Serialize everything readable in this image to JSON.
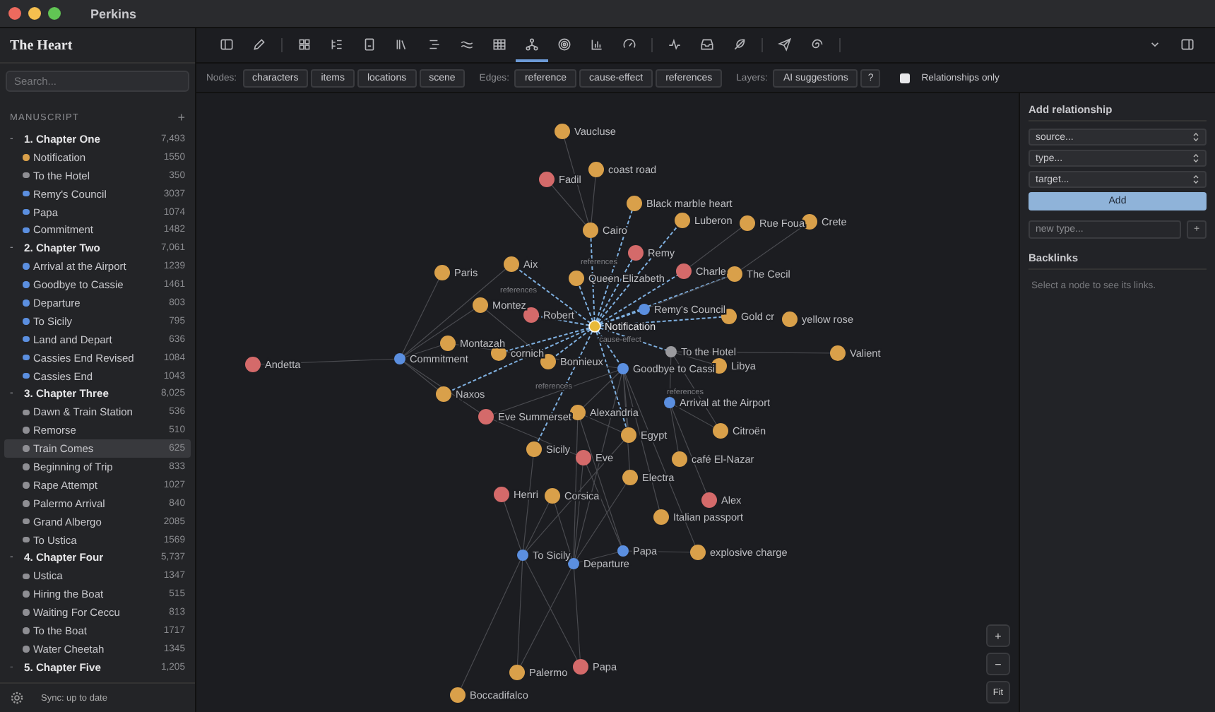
{
  "window": {
    "title": "Perkins"
  },
  "sidebar": {
    "project_title": "The Heart",
    "search": {
      "placeholder": "Search..."
    },
    "section_label": "MANUSCRIPT",
    "add_button": "+",
    "chapters": [
      {
        "toggle": "-",
        "title": "1. Chapter One",
        "count": "7,493",
        "expanded": true,
        "children": [
          {
            "title": "Notification",
            "count": "1550",
            "color": "#d9a04a",
            "selected": false
          },
          {
            "title": "To the Hotel",
            "count": "350",
            "color": "#8e8e93",
            "selected": false
          },
          {
            "title": "Remy's Council",
            "count": "3037",
            "color": "#5b8fe0",
            "selected": false
          },
          {
            "title": "Papa",
            "count": "1074",
            "color": "#5b8fe0",
            "selected": false
          },
          {
            "title": "Commitment",
            "count": "1482",
            "color": "#5b8fe0",
            "selected": false
          }
        ]
      },
      {
        "toggle": "-",
        "title": "2. Chapter Two",
        "count": "7,061",
        "expanded": true,
        "children": [
          {
            "title": "Arrival at the Airport",
            "count": "1239",
            "color": "#5b8fe0",
            "selected": false
          },
          {
            "title": "Goodbye to Cassie",
            "count": "1461",
            "color": "#5b8fe0",
            "selected": false
          },
          {
            "title": "Departure",
            "count": "803",
            "color": "#5b8fe0",
            "selected": false
          },
          {
            "title": "To Sicily",
            "count": "795",
            "color": "#5b8fe0",
            "selected": false
          },
          {
            "title": "Land and Depart",
            "count": "636",
            "color": "#5b8fe0",
            "selected": false
          },
          {
            "title": "Cassies End Revised",
            "count": "1084",
            "color": "#5b8fe0",
            "selected": false
          },
          {
            "title": "Cassies End",
            "count": "1043",
            "color": "#5b8fe0",
            "selected": false
          }
        ]
      },
      {
        "toggle": "-",
        "title": "3. Chapter Three",
        "count": "8,025",
        "expanded": true,
        "children": [
          {
            "title": "Dawn & Train Station",
            "count": "536",
            "color": "#8e8e93",
            "selected": false
          },
          {
            "title": "Remorse",
            "count": "510",
            "color": "#8e8e93",
            "selected": false
          },
          {
            "title": "Train Comes",
            "count": "625",
            "color": "#8e8e93",
            "selected": true
          },
          {
            "title": "Beginning of Trip",
            "count": "833",
            "color": "#8e8e93",
            "selected": false
          },
          {
            "title": "Rape Attempt",
            "count": "1027",
            "color": "#8e8e93",
            "selected": false
          },
          {
            "title": "Palermo Arrival",
            "count": "840",
            "color": "#8e8e93",
            "selected": false
          },
          {
            "title": "Grand Albergo",
            "count": "2085",
            "color": "#8e8e93",
            "selected": false
          },
          {
            "title": "To Ustica",
            "count": "1569",
            "color": "#8e8e93",
            "selected": false
          }
        ]
      },
      {
        "toggle": "-",
        "title": "4. Chapter Four",
        "count": "5,737",
        "expanded": true,
        "children": [
          {
            "title": "Ustica",
            "count": "1347",
            "color": "#8e8e93",
            "selected": false
          },
          {
            "title": "Hiring the Boat",
            "count": "515",
            "color": "#8e8e93",
            "selected": false
          },
          {
            "title": "Waiting For Ceccu",
            "count": "813",
            "color": "#8e8e93",
            "selected": false
          },
          {
            "title": "To the Boat",
            "count": "1717",
            "color": "#8e8e93",
            "selected": false
          },
          {
            "title": "Water Cheetah",
            "count": "1345",
            "color": "#8e8e93",
            "selected": false
          }
        ]
      },
      {
        "toggle": "-",
        "title": "5. Chapter Five",
        "count": "1,205",
        "expanded": false
      }
    ],
    "status": "Sync: up to date"
  },
  "toolbar": [
    {
      "selected": false
    },
    {
      "selected": false
    },
    {
      "selected": false
    },
    {
      "selected": false
    },
    {
      "selected": false
    },
    {
      "selected": false
    },
    {
      "selected": false
    },
    {
      "selected": false
    },
    {
      "selected": false
    },
    {
      "selected": true
    },
    {
      "selected": false
    },
    {
      "selected": false
    },
    {
      "selected": false
    },
    {
      "selected": false
    },
    {
      "selected": false
    },
    {
      "selected": false
    },
    {
      "selected": false
    },
    {
      "selected": false
    },
    {
      "selected": false
    },
    {
      "selected": false
    }
  ],
  "filters": {
    "nodes_label": "Nodes:",
    "nodes": [
      "characters",
      "items",
      "locations",
      "scene"
    ],
    "edges_label": "Edges:",
    "edges": [
      "reference",
      "cause-effect",
      "references"
    ],
    "layers_label": "Layers:",
    "layers": [
      "AI suggestions"
    ],
    "help": "?",
    "relationships_only": {
      "label": "Relationships only",
      "checked": false
    }
  },
  "graph": {
    "nodes": [
      {
        "name": "Vaucluse",
        "color": "#d9a04a",
        "kind": "entity",
        "selected": false
      },
      {
        "name": "coast road",
        "color": "#d9a04a",
        "kind": "entity",
        "selected": false
      },
      {
        "name": "Fadil",
        "color": "#d46a6a",
        "kind": "entity",
        "selected": false
      },
      {
        "name": "Black marble heart",
        "color": "#d9a04a",
        "kind": "entity",
        "selected": false
      },
      {
        "name": "Cairo",
        "color": "#d9a04a",
        "kind": "entity",
        "selected": false
      },
      {
        "name": "Luberon",
        "color": "#d9a04a",
        "kind": "entity",
        "selected": false
      },
      {
        "name": "Rue Foua",
        "color": "#d9a04a",
        "kind": "entity",
        "selected": false
      },
      {
        "name": "Crete",
        "color": "#d9a04a",
        "kind": "entity",
        "selected": false
      },
      {
        "name": "Remy",
        "color": "#d46a6a",
        "kind": "entity",
        "selected": false
      },
      {
        "name": "Paris",
        "color": "#d9a04a",
        "kind": "entity",
        "selected": false
      },
      {
        "name": "Aix",
        "color": "#d9a04a",
        "kind": "entity",
        "selected": false
      },
      {
        "name": "Queen Elizabeth",
        "color": "#d9a04a",
        "kind": "entity",
        "selected": false
      },
      {
        "name": "Charle",
        "color": "#d46a6a",
        "kind": "entity",
        "selected": false
      },
      {
        "name": "The Cecil",
        "color": "#d9a04a",
        "kind": "entity",
        "selected": false
      },
      {
        "name": "Montez",
        "color": "#d9a04a",
        "kind": "entity",
        "selected": false
      },
      {
        "name": "Robert",
        "color": "#d46a6a",
        "kind": "entity",
        "selected": false
      },
      {
        "name": "Remy's Council",
        "color": "#5b8fe0",
        "kind": "scene",
        "selected": false
      },
      {
        "name": "Notification",
        "color": "#e8b93a",
        "kind": "scene",
        "selected": true
      },
      {
        "name": "Gold cr",
        "color": "#d9a04a",
        "kind": "entity",
        "selected": false
      },
      {
        "name": "yellow rose",
        "color": "#d9a04a",
        "kind": "entity",
        "selected": false
      },
      {
        "name": "Montazah",
        "color": "#d9a04a",
        "kind": "entity",
        "selected": false
      },
      {
        "name": "cornich",
        "color": "#d9a04a",
        "kind": "entity",
        "selected": false
      },
      {
        "name": "Commitment",
        "color": "#5b8fe0",
        "kind": "scene",
        "selected": false
      },
      {
        "name": "Andetta",
        "color": "#d46a6a",
        "kind": "entity",
        "selected": false
      },
      {
        "name": "Bonnieux",
        "color": "#d9a04a",
        "kind": "entity",
        "selected": false
      },
      {
        "name": "To the Hotel",
        "color": "#9a9a9e",
        "kind": "scene",
        "selected": false
      },
      {
        "name": "Goodbye to Cassi",
        "color": "#5b8fe0",
        "kind": "scene",
        "selected": false
      },
      {
        "name": "Libya",
        "color": "#d9a04a",
        "kind": "entity",
        "selected": false
      },
      {
        "name": "Valient",
        "color": "#d9a04a",
        "kind": "entity",
        "selected": false
      },
      {
        "name": "Naxos",
        "color": "#d9a04a",
        "kind": "entity",
        "selected": false
      },
      {
        "name": "Eve Summerset",
        "color": "#d46a6a",
        "kind": "entity",
        "selected": false
      },
      {
        "name": "Alexandria",
        "color": "#d9a04a",
        "kind": "entity",
        "selected": false
      },
      {
        "name": "Arrival at the Airport",
        "color": "#5b8fe0",
        "kind": "scene",
        "selected": false
      },
      {
        "name": "Egypt",
        "color": "#d9a04a",
        "kind": "entity",
        "selected": false
      },
      {
        "name": "Citroën",
        "color": "#d9a04a",
        "kind": "entity",
        "selected": false
      },
      {
        "name": "Sicily",
        "color": "#d9a04a",
        "kind": "entity",
        "selected": false
      },
      {
        "name": "Eve",
        "color": "#d46a6a",
        "kind": "entity",
        "selected": false
      },
      {
        "name": "café El-Nazar",
        "color": "#d9a04a",
        "kind": "entity",
        "selected": false
      },
      {
        "name": "Electra",
        "color": "#d9a04a",
        "kind": "entity",
        "selected": false
      },
      {
        "name": "Henri",
        "color": "#d46a6a",
        "kind": "entity",
        "selected": false
      },
      {
        "name": "Corsica",
        "color": "#d9a04a",
        "kind": "entity",
        "selected": false
      },
      {
        "name": "Alex",
        "color": "#d46a6a",
        "kind": "entity",
        "selected": false
      },
      {
        "name": "Italian passport",
        "color": "#d9a04a",
        "kind": "entity",
        "selected": false
      },
      {
        "name": "To Sicily",
        "color": "#5b8fe0",
        "kind": "scene",
        "selected": false
      },
      {
        "name": "Departure",
        "color": "#5b8fe0",
        "kind": "scene",
        "selected": false
      },
      {
        "name": "Papa",
        "color": "#5b8fe0",
        "kind": "scene",
        "selected": false
      },
      {
        "name": "explosive charge",
        "color": "#d9a04a",
        "kind": "entity",
        "selected": false
      },
      {
        "name": "Palermo",
        "color": "#d9a04a",
        "kind": "entity",
        "selected": false
      },
      {
        "name": "Papa",
        "color": "#d46a6a",
        "kind": "entity",
        "selected": false
      },
      {
        "name": "Boccadifalco",
        "color": "#d9a04a",
        "kind": "entity",
        "selected": false
      }
    ],
    "edge_labels": [
      "references",
      "references",
      "cause-effect",
      "references",
      "references"
    ],
    "zoom_in": "+",
    "zoom_out": "−",
    "fit": "Fit"
  },
  "panel": {
    "add_title": "Add relationship",
    "source": "source...",
    "type": "type...",
    "target": "target...",
    "add_button": "Add",
    "new_type": {
      "placeholder": "new type..."
    },
    "new_type_button": "+",
    "backlinks_title": "Backlinks",
    "backlinks_hint": "Select a node to see its links."
  }
}
